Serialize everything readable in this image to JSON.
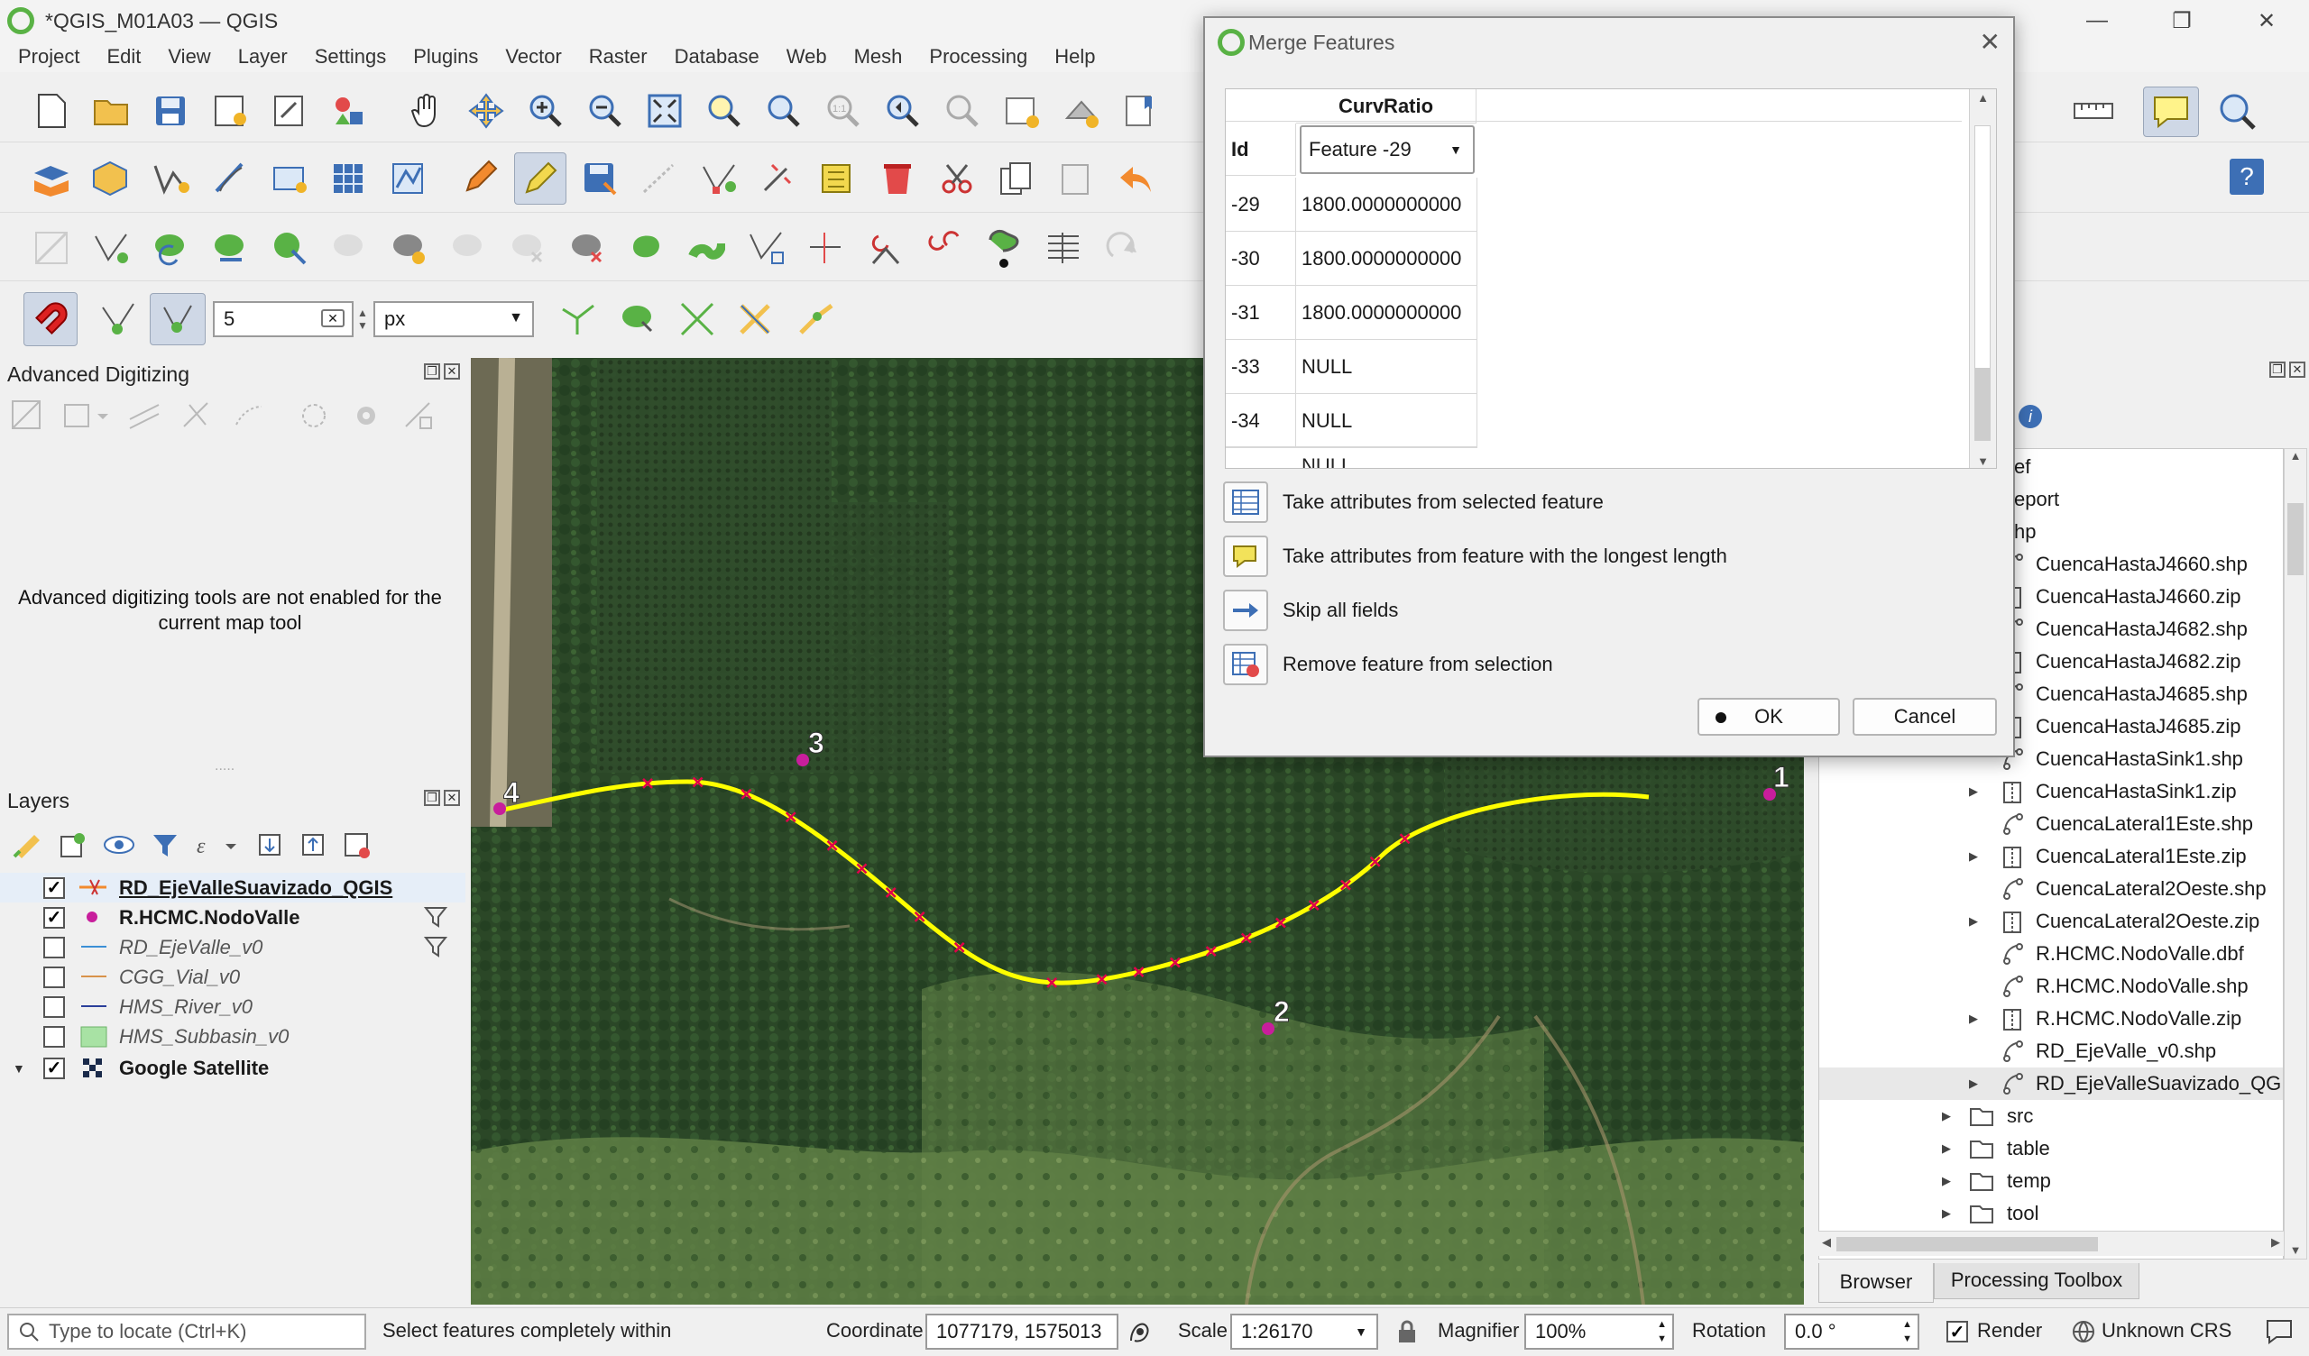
{
  "window": {
    "title": "*QGIS_M01A03 — QGIS",
    "minimize": "—",
    "restore": "❐",
    "close": "✕"
  },
  "menu": [
    "Project",
    "Edit",
    "View",
    "Layer",
    "Settings",
    "Plugins",
    "Vector",
    "Raster",
    "Database",
    "Web",
    "Mesh",
    "Processing",
    "Help"
  ],
  "snapping": {
    "tolerance": "5",
    "unit": "px"
  },
  "advanced_digitizing": {
    "title": "Advanced Digitizing",
    "message": "Advanced digitizing tools are not enabled for the current map tool"
  },
  "layers_panel": {
    "title": "Layers",
    "items": [
      {
        "name": "RD_EjeValleSuavizado_QGIS",
        "checked": true,
        "style": "bold-underline",
        "symbol": "line-edit"
      },
      {
        "name": "R.HCMC.NodoValle",
        "checked": true,
        "style": "bold",
        "symbol": "point"
      },
      {
        "name": "RD_EjeValle_v0",
        "checked": false,
        "style": "italic",
        "symbol": "line-blue"
      },
      {
        "name": "CGG_Vial_v0",
        "checked": false,
        "style": "italic",
        "symbol": "line-orange"
      },
      {
        "name": "HMS_River_v0",
        "checked": false,
        "style": "italic",
        "symbol": "line-navy"
      },
      {
        "name": "HMS_Subbasin_v0",
        "checked": false,
        "style": "italic",
        "symbol": "polygon-green"
      },
      {
        "name": "Google Satellite",
        "checked": true,
        "style": "bold",
        "symbol": "raster"
      }
    ]
  },
  "map_labels": [
    "1",
    "2",
    "3",
    "4"
  ],
  "browser": {
    "partial_items": [
      "ef",
      "eport",
      "hp"
    ],
    "files": [
      "CuencaHastaJ4660.shp",
      "CuencaHastaJ4660.zip",
      "CuencaHastaJ4682.shp",
      "CuencaHastaJ4682.zip",
      "CuencaHastaJ4685.shp",
      "CuencaHastaJ4685.zip",
      "CuencaHastaSink1.shp",
      "CuencaHastaSink1.zip",
      "CuencaLateral1Este.shp",
      "CuencaLateral1Este.zip",
      "CuencaLateral2Oeste.shp",
      "CuencaLateral2Oeste.zip",
      "R.HCMC.NodoValle.dbf",
      "R.HCMC.NodoValle.shp",
      "R.HCMC.NodoValle.zip",
      "RD_EjeValle_v0.shp",
      "RD_EjeValleSuavizado_QGIS"
    ],
    "folders": [
      "src",
      "table",
      "temp",
      "tool"
    ],
    "tabs": [
      "Browser",
      "Processing Toolbox"
    ]
  },
  "merge_dialog": {
    "title": "Merge Features",
    "column_header": "CurvRatio",
    "id_header": "Id",
    "selected_feature": "Feature -29",
    "rows": [
      {
        "id": "-29",
        "value": "1800.0000000000"
      },
      {
        "id": "-30",
        "value": "1800.0000000000"
      },
      {
        "id": "-31",
        "value": "1800.0000000000"
      },
      {
        "id": "-33",
        "value": "NULL"
      },
      {
        "id": "-34",
        "value": "NULL"
      }
    ],
    "partial_cell": "NULL",
    "options": [
      "Take attributes from selected feature",
      "Take attributes from feature with the longest length",
      "Skip all fields",
      "Remove feature from selection"
    ],
    "ok": "OK",
    "cancel": "Cancel"
  },
  "statusbar": {
    "locate_placeholder": "Type to locate (Ctrl+K)",
    "message": "Select features completely within",
    "coordinate_label": "Coordinate",
    "coordinate": "1077179, 1575013",
    "scale_label": "Scale",
    "scale": "1:26170",
    "magnifier_label": "Magnifier",
    "magnifier": "100%",
    "rotation_label": "Rotation",
    "rotation": "0.0 °",
    "render_label": "Render",
    "crs": "Unknown CRS"
  },
  "colors": {
    "selection_line": "#ffff00",
    "vertex": "#e0004a",
    "node_point": "#c81e9c",
    "qgis_green": "#59b245"
  }
}
